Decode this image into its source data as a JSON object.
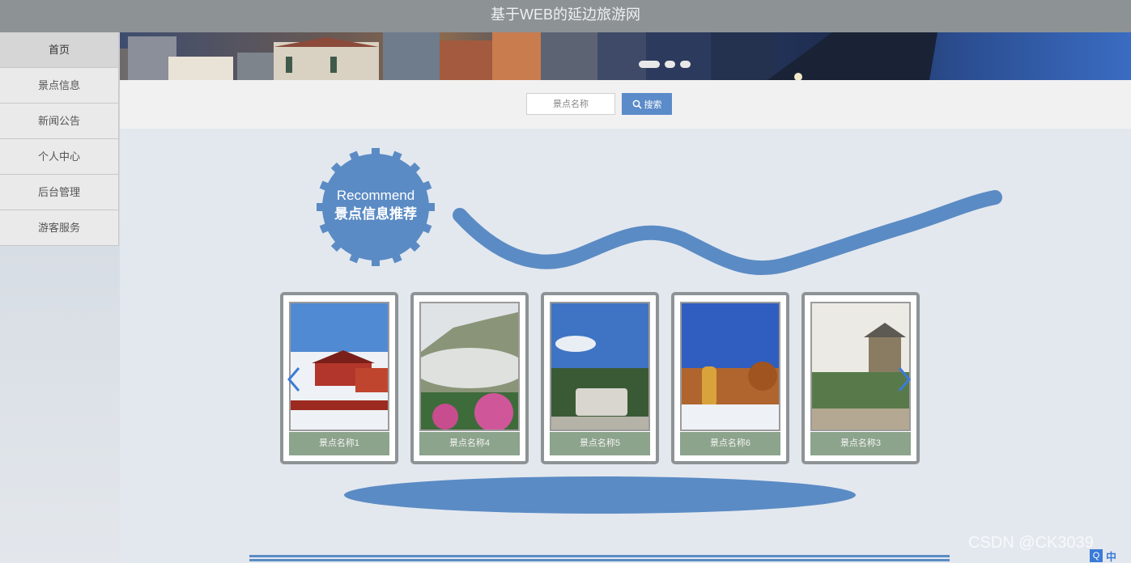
{
  "header": {
    "title": "基于WEB的延边旅游网"
  },
  "sidebar": {
    "items": [
      {
        "label": "首页"
      },
      {
        "label": "景点信息"
      },
      {
        "label": "新闻公告"
      },
      {
        "label": "个人中心"
      },
      {
        "label": "后台管理"
      },
      {
        "label": "游客服务"
      }
    ]
  },
  "banner": {
    "slide_count": 3,
    "active_slide": 1
  },
  "search": {
    "placeholder": "景点名称",
    "button_label": "搜索",
    "icon": "search-icon"
  },
  "recommend": {
    "title_en": "Recommend",
    "title_cn": "景点信息推荐"
  },
  "cards": [
    {
      "caption": "景点名称1"
    },
    {
      "caption": "景点名称4"
    },
    {
      "caption": "景点名称5"
    },
    {
      "caption": "景点名称6"
    },
    {
      "caption": "景点名称3"
    }
  ],
  "carousel": {
    "prev_icon": "chevron-left-icon",
    "next_icon": "chevron-right-icon"
  },
  "overlay": {
    "watermark": "CSDN @CK3039",
    "ime_q": "Q",
    "ime_lang": "中"
  },
  "colors": {
    "accent": "#5b8bc9",
    "caption_bg": "#8ca38c",
    "topbar": "#8d9294"
  }
}
